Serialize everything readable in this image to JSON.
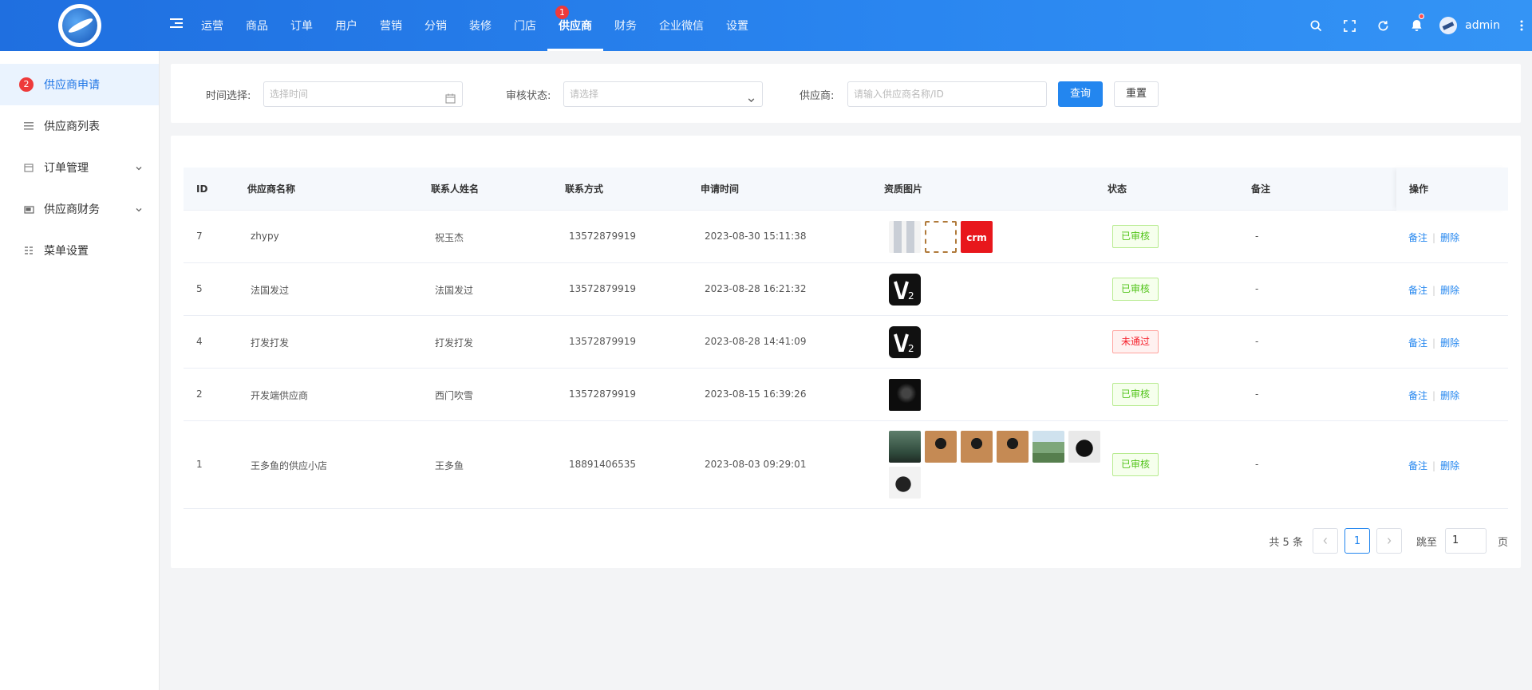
{
  "nav": {
    "items": [
      {
        "label": "运营"
      },
      {
        "label": "商品"
      },
      {
        "label": "订单"
      },
      {
        "label": "用户"
      },
      {
        "label": "营销"
      },
      {
        "label": "分销"
      },
      {
        "label": "装修"
      },
      {
        "label": "门店"
      },
      {
        "label": "供应商",
        "badge": "1"
      },
      {
        "label": "财务"
      },
      {
        "label": "企业微信"
      },
      {
        "label": "设置"
      }
    ],
    "active_index": 8,
    "user": "admin"
  },
  "sidebar": {
    "items": [
      {
        "label": "供应商申请",
        "badge": "2",
        "icon": "badge"
      },
      {
        "label": "供应商列表",
        "icon": "list-icon"
      },
      {
        "label": "订单管理",
        "icon": "calendar-icon"
      },
      {
        "label": "供应商财务",
        "icon": "wallet-icon"
      },
      {
        "label": "菜单设置",
        "icon": "grid-icon"
      }
    ]
  },
  "filter": {
    "time_label": "时间选择:",
    "time_placeholder": "选择时间",
    "status_label": "审核状态:",
    "status_placeholder": "请选择",
    "supplier_label": "供应商:",
    "supplier_placeholder": "请输入供应商名称/ID",
    "search_button": "查询",
    "reset_button": "重置"
  },
  "table": {
    "columns": [
      "ID",
      "供应商名称",
      "联系人姓名",
      "联系方式",
      "申请时间",
      "资质图片",
      "状态",
      "备注",
      "操作"
    ],
    "rows": [
      {
        "id": "7",
        "name": "zhypy",
        "contact": "祝玉杰",
        "phone": "13572879919",
        "time": "2023-08-30 15:11:38",
        "images": [
          "bottles",
          "frame",
          "logo-red"
        ],
        "status": "已审核",
        "status_type": "ok",
        "note": "-"
      },
      {
        "id": "5",
        "name": "法国发过",
        "contact": "法国发过",
        "phone": "13572879919",
        "time": "2023-08-28 16:21:32",
        "images": [
          "v2"
        ],
        "status": "已审核",
        "status_type": "ok",
        "note": "-"
      },
      {
        "id": "4",
        "name": "打发打发",
        "contact": "打发打发",
        "phone": "13572879919",
        "time": "2023-08-28 14:41:09",
        "images": [
          "v2"
        ],
        "status": "未通过",
        "status_type": "no",
        "note": "-"
      },
      {
        "id": "2",
        "name": "开发端供应商",
        "contact": "西门吹雪",
        "phone": "13572879919",
        "time": "2023-08-15 16:39:26",
        "images": [
          "dark"
        ],
        "status": "已审核",
        "status_type": "ok",
        "note": "-"
      },
      {
        "id": "1",
        "name": "王多鱼的供应小店",
        "contact": "王多鱼",
        "phone": "18891406535",
        "time": "2023-08-03 09:29:01",
        "images": [
          "forest",
          "portrait",
          "portrait",
          "portrait",
          "landscape",
          "girl",
          "mono"
        ],
        "status": "已审核",
        "status_type": "ok",
        "note": "-"
      }
    ],
    "ops": {
      "note": "备注",
      "delete": "删除"
    }
  },
  "pagination": {
    "total_text": "共 5 条",
    "current_page": "1",
    "jump_label": "跳至",
    "jump_value": "1",
    "page_suffix": "页"
  },
  "colors": {
    "primary": "#2386ef",
    "ok": "#52c41a",
    "danger": "#f5222d"
  }
}
